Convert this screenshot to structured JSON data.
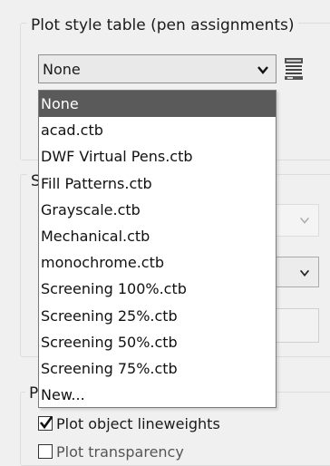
{
  "plot_style_section": {
    "title": "Plot style table (pen assignments)",
    "selected_value": "None",
    "options": [
      "None",
      "acad.ctb",
      "DWF Virtual Pens.ctb",
      "Fill Patterns.ctb",
      "Grayscale.ctb",
      "Mechanical.ctb",
      "monochrome.ctb",
      "Screening 100%.ctb",
      "Screening 25%.ctb",
      "Screening 50%.ctb",
      "Screening 75%.ctb",
      "New..."
    ],
    "highlighted_index": 0
  },
  "hidden_section_titles": {
    "middle": "S",
    "bottom": "P"
  },
  "plot_options": {
    "plot_object_lineweights_label": "Plot object lineweights",
    "plot_object_lineweights_checked": true,
    "plot_transparency_label": "Plot transparency"
  },
  "icons": {
    "combo_arrow": "chevron-down-icon",
    "edit_table": "edit-plot-style-icon",
    "check": "checkmark-icon"
  },
  "colors": {
    "highlight": "#5a5a5a",
    "background": "#f0f0f0"
  }
}
